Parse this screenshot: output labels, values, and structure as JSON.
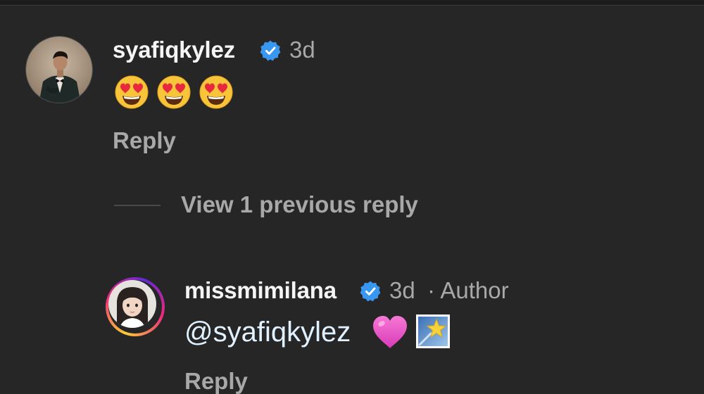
{
  "comment": {
    "username": "syafiqkylez",
    "time": "3d",
    "emojis": [
      "heart-eyes-emoji",
      "heart-eyes-emoji",
      "heart-eyes-emoji"
    ],
    "reply_label": "Reply"
  },
  "thread": {
    "view_replies_label": "View 1 previous reply"
  },
  "reply": {
    "username": "missmimilana",
    "time": "3d",
    "author_badge": "· Author",
    "mention": "@syafiqkylez",
    "emojis": [
      "pink-heart-emoji",
      "shooting-star-emoji"
    ],
    "reply_label": "Reply"
  },
  "colors": {
    "background": "#262626",
    "verified": "#3897f0",
    "muted": "#a8a8a8",
    "mention": "#e0f1ff"
  }
}
